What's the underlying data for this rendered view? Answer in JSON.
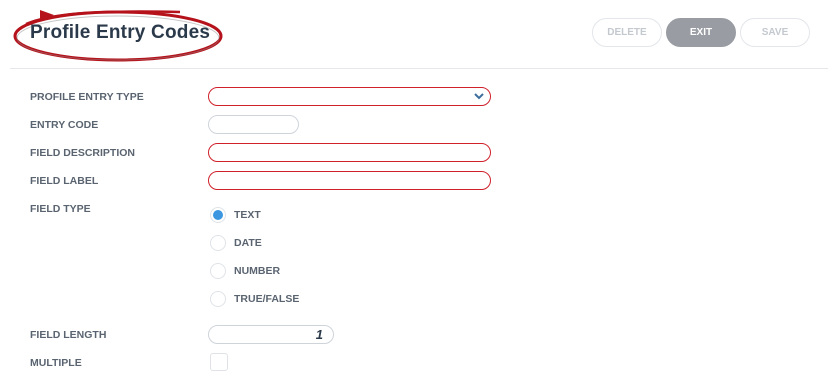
{
  "page": {
    "title": "Profile Entry Codes"
  },
  "toolbar": {
    "delete_label": "DELETE",
    "exit_label": "EXIT",
    "save_label": "SAVE"
  },
  "form": {
    "profile_entry_type": {
      "label": "PROFILE ENTRY TYPE",
      "value": ""
    },
    "entry_code": {
      "label": "ENTRY CODE",
      "value": ""
    },
    "field_description": {
      "label": "FIELD DESCRIPTION",
      "value": ""
    },
    "field_label": {
      "label": "FIELD LABEL",
      "value": ""
    },
    "field_type": {
      "label": "FIELD TYPE",
      "options": [
        "TEXT",
        "DATE",
        "NUMBER",
        "TRUE/FALSE"
      ],
      "selected": "TEXT"
    },
    "field_length": {
      "label": "FIELD LENGTH",
      "value": "1"
    },
    "multiple": {
      "label": "MULTIPLE",
      "checked": false
    }
  },
  "colors": {
    "required_border": "#d0202a",
    "radio_selected": "#3d97e0",
    "exit_button": "#999da3",
    "title_highlight": "#b5121b"
  },
  "icons": {
    "select_chevron": "chevron-down-icon"
  }
}
